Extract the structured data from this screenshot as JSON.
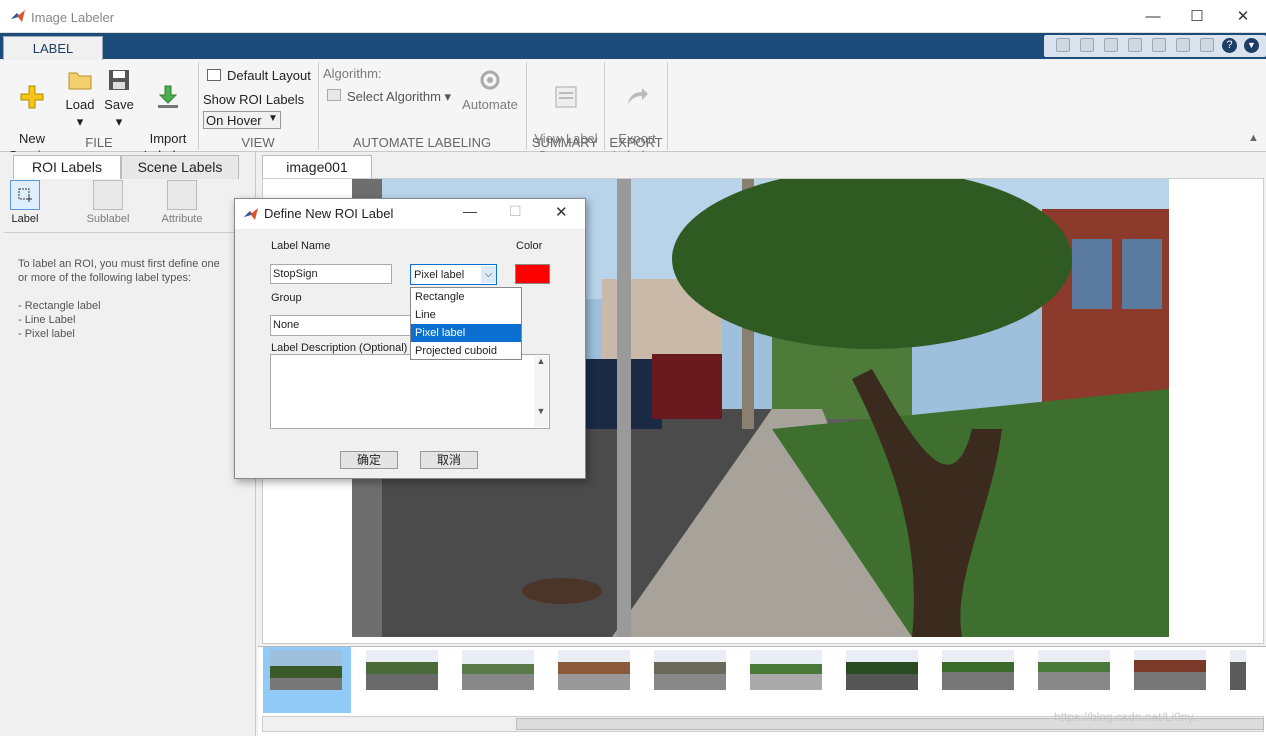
{
  "window": {
    "title": "Image Labeler",
    "controls": [
      "—",
      "☐",
      "✕"
    ]
  },
  "ribbon": {
    "active_tab": "LABEL"
  },
  "toolstrip": {
    "file": {
      "new_session": "New\nSession",
      "load": "Load",
      "save": "Save",
      "import_labels": "Import\nLabels ▾",
      "section": "FILE"
    },
    "view": {
      "default_layout": "Default Layout",
      "show_roi_labels": "Show ROI Labels",
      "on_hover": "On Hover",
      "section": "VIEW"
    },
    "automate": {
      "algorithm_label": "Algorithm:",
      "select_algorithm": "Select Algorithm ▾",
      "automate": "Automate",
      "section": "AUTOMATE LABELING"
    },
    "summary": {
      "view_label_summary": "View Label\nSummary",
      "section": "SUMMARY"
    },
    "export": {
      "export_labels": "Export\nLabels ▾",
      "section": "EXPORT"
    }
  },
  "left_panel": {
    "tabs": [
      "ROI Labels",
      "Scene Labels"
    ],
    "tools": [
      "Label",
      "Sublabel",
      "Attribute"
    ],
    "help_text": "To label an ROI, you must first define one\nor more of the following label types:\n\n- Rectangle label\n- Line Label\n- Pixel label"
  },
  "image_panel": {
    "tab": "image001"
  },
  "dialog": {
    "title": "Define New ROI Label",
    "label_name_label": "Label Name",
    "label_name_value": "StopSign",
    "type_value": "Pixel label",
    "color_label": "Color",
    "color_value": "#ff0000",
    "group_label": "Group",
    "group_value": "None",
    "description_label": "Label Description (Optional)",
    "description_value": "",
    "type_options": [
      "Rectangle",
      "Line",
      "Pixel label",
      "Projected cuboid"
    ],
    "ok": "确定",
    "cancel": "取消"
  },
  "watermark": "https://blog.csdn.net/Li0ny..."
}
